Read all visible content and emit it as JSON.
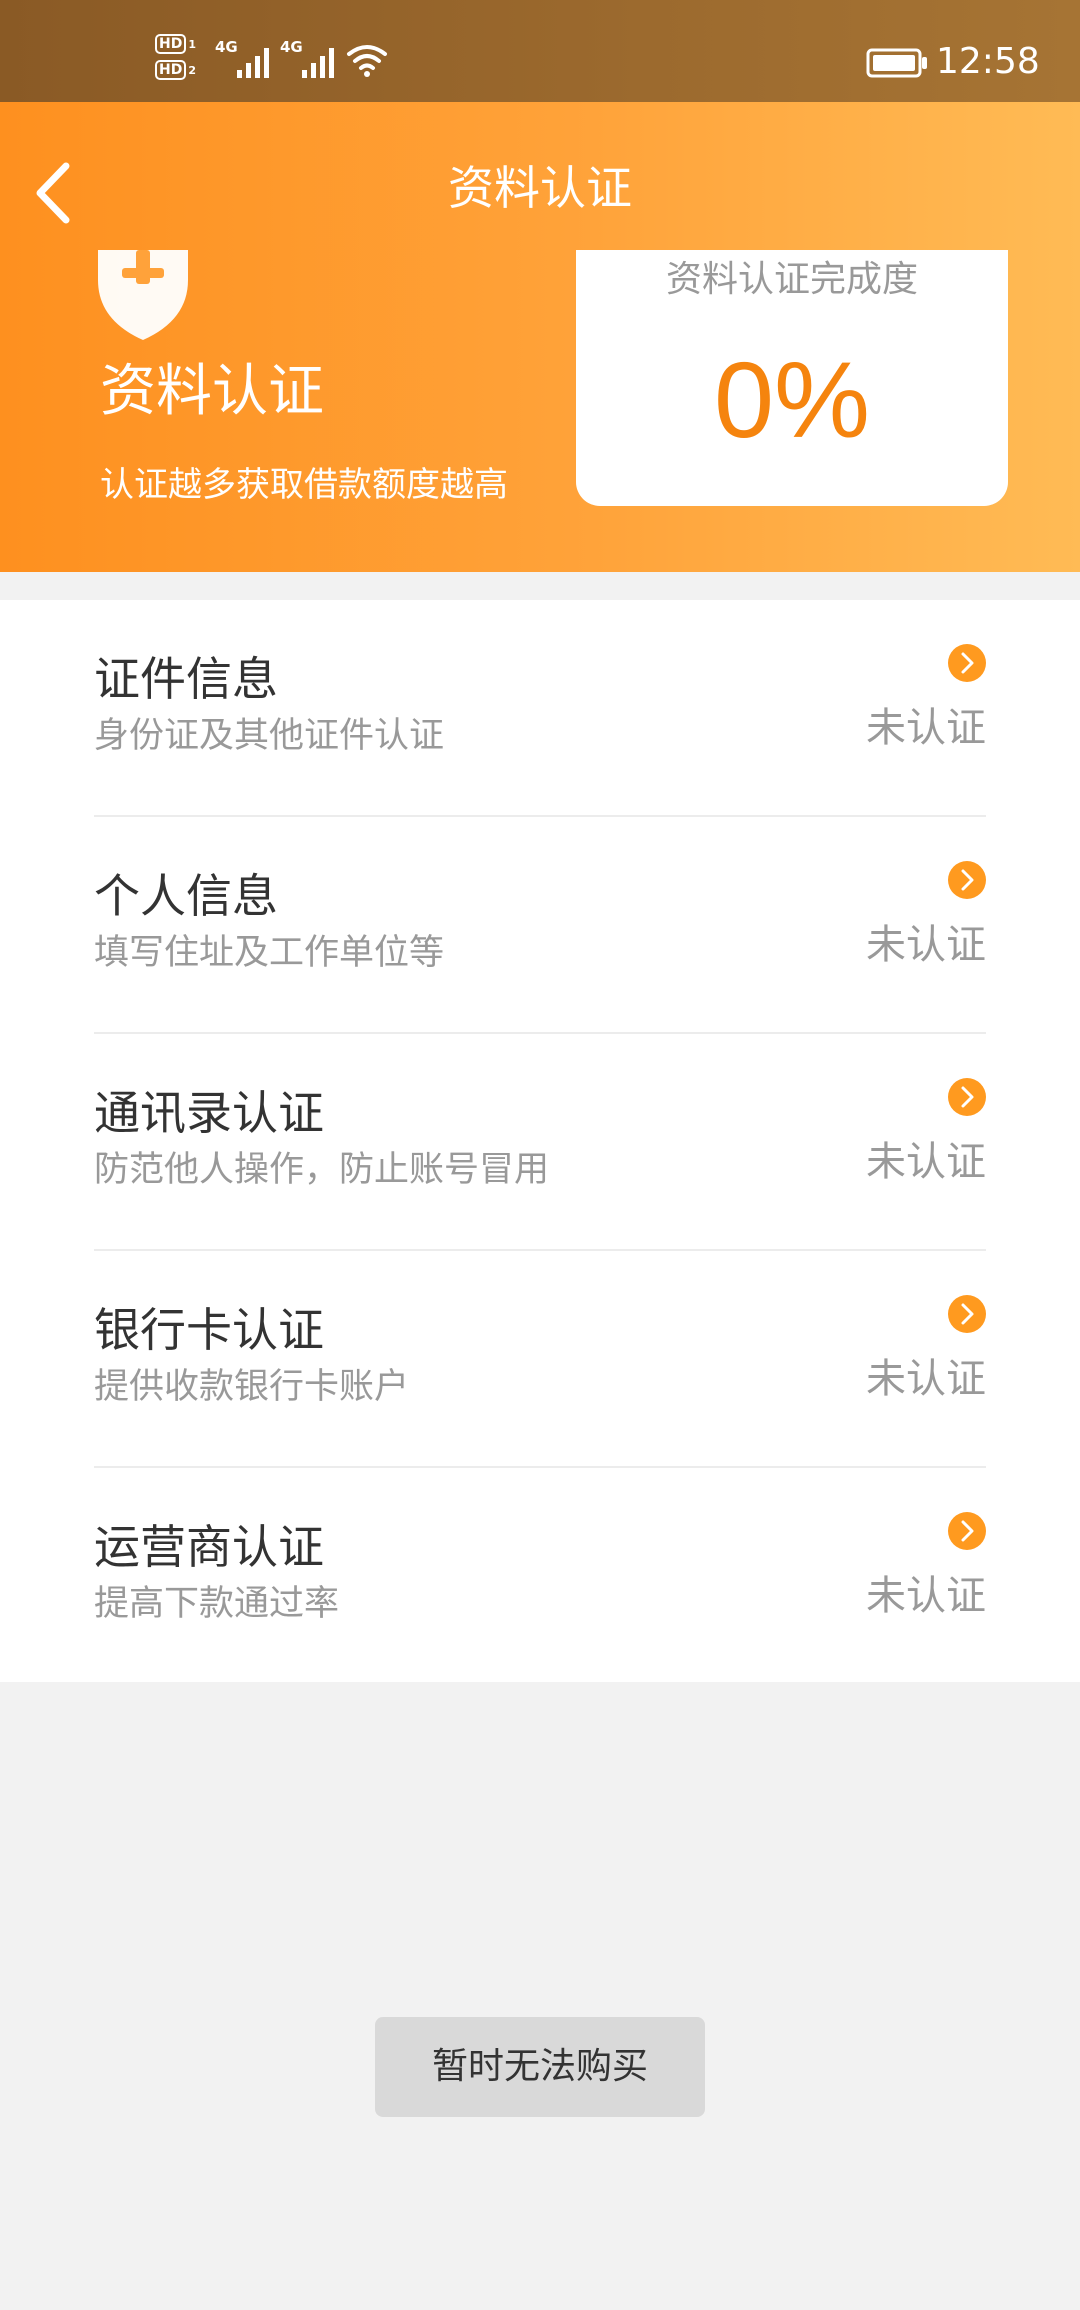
{
  "status_bar": {
    "hd1": "HD",
    "hd1_sub": "1",
    "hd2": "HD",
    "hd2_sub": "2",
    "sim1_network": "4G",
    "sim2_network": "4G",
    "time": "12:58",
    "icons": [
      "signal-icon",
      "signal-icon",
      "wifi-icon",
      "battery-icon"
    ]
  },
  "nav": {
    "back_icon": "chevron-left-icon",
    "title": "资料认证"
  },
  "hero": {
    "icon": "shield-icon",
    "title": "资料认证",
    "subtitle": "认证越多获取借款额度越高"
  },
  "progress": {
    "label": "资料认证完成度",
    "value": "0%",
    "percent": 0
  },
  "items": [
    {
      "title": "证件信息",
      "desc": "身份证及其他证件认证",
      "status": "未认证",
      "icon": "chevron-right-circle-icon"
    },
    {
      "title": "个人信息",
      "desc": "填写住址及工作单位等",
      "status": "未认证",
      "icon": "chevron-right-circle-icon"
    },
    {
      "title": "通讯录认证",
      "desc": "防范他人操作，防止账号冒用",
      "status": "未认证",
      "icon": "chevron-right-circle-icon"
    },
    {
      "title": "银行卡认证",
      "desc": "提供收款银行卡账户",
      "status": "未认证",
      "icon": "chevron-right-circle-icon"
    },
    {
      "title": "运营商认证",
      "desc": "提高下款通过率",
      "status": "未认证",
      "icon": "chevron-right-circle-icon"
    }
  ],
  "footer": {
    "buy_button_label": "暂时无法购买"
  },
  "colors": {
    "accent": "#f5840e",
    "header_start": "#fe901f",
    "header_end": "#ffbb55",
    "arrow_badge": "#ff9a1f",
    "status_text": "#999999",
    "button_bg": "#d9d9d9"
  }
}
